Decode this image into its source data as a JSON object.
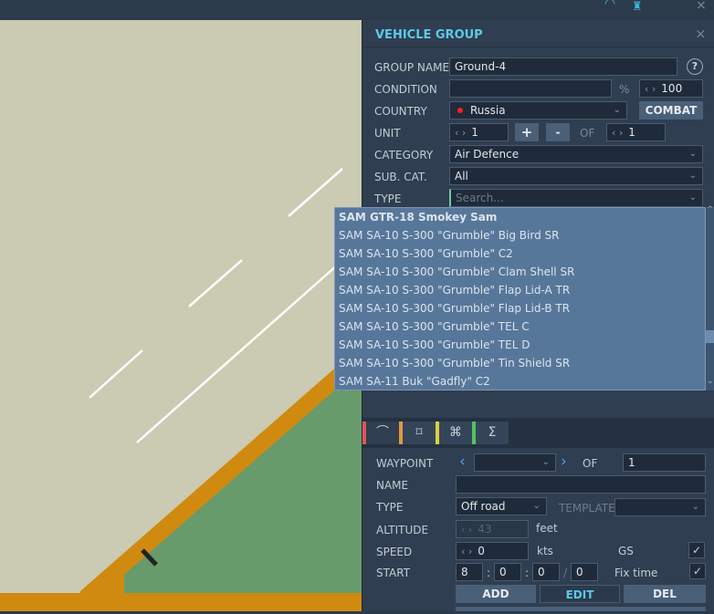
{
  "header": {
    "title": "VEHICLE GROUP",
    "help": "?"
  },
  "group": {
    "group_name_label": "GROUP NAME",
    "group_name": "Ground-4",
    "condition_label": "CONDITION",
    "condition_unit": "%",
    "condition_value": "100",
    "country_label": "COUNTRY",
    "country": "Russia",
    "combat_label": "COMBAT",
    "unit_label": "UNIT",
    "unit_value": "1",
    "plus": "+",
    "minus": "-",
    "of_label": "OF",
    "unit_total": "1",
    "category_label": "CATEGORY",
    "category": "Air Defence",
    "subcat_label": "SUB. CAT.",
    "subcat": "All",
    "type_label": "TYPE",
    "type_placeholder": "Search..."
  },
  "type_options": [
    "SAM GTR-18 Smokey Sam",
    "SAM SA-10 S-300 \"Grumble\" Big Bird SR",
    "SAM SA-10 S-300 \"Grumble\" C2",
    "SAM SA-10 S-300 \"Grumble\" Clam Shell SR",
    "SAM SA-10 S-300 \"Grumble\" Flap Lid-A TR",
    "SAM SA-10 S-300 \"Grumble\" Flap Lid-B TR",
    "SAM SA-10 S-300 \"Grumble\" TEL C",
    "SAM SA-10 S-300 \"Grumble\" TEL D",
    "SAM SA-10 S-300 \"Grumble\" Tin Shield SR",
    "SAM SA-11 Buk \"Gadfly\" C2"
  ],
  "tabs": [
    {
      "icon": "route-icon",
      "color": "#e05555"
    },
    {
      "icon": "target-icon",
      "color": "#e09a40"
    },
    {
      "icon": "command-icon",
      "color": "#d8d040"
    },
    {
      "icon": "summary-icon",
      "color": "#55c060"
    }
  ],
  "waypoint": {
    "waypoint_label": "WAYPOINT",
    "of_label": "OF",
    "total": "1",
    "name_label": "NAME",
    "name": "",
    "type_label": "TYPE",
    "type": "Off road",
    "template_label": "TEMPLATE",
    "altitude_label": "ALTITUDE",
    "altitude": "43",
    "altitude_unit": "feet",
    "speed_label": "SPEED",
    "speed": "0",
    "speed_unit": "kts",
    "gs_label": "GS",
    "start_label": "START",
    "start_h": "8",
    "start_m": "0",
    "start_s": "0",
    "start_d": "0",
    "fix_time_label": "Fix time",
    "add": "ADD",
    "edit": "EDIT",
    "del": "DEL"
  },
  "colors": {
    "accent": "#5fc8e8",
    "country_dot": "#ff2020"
  }
}
